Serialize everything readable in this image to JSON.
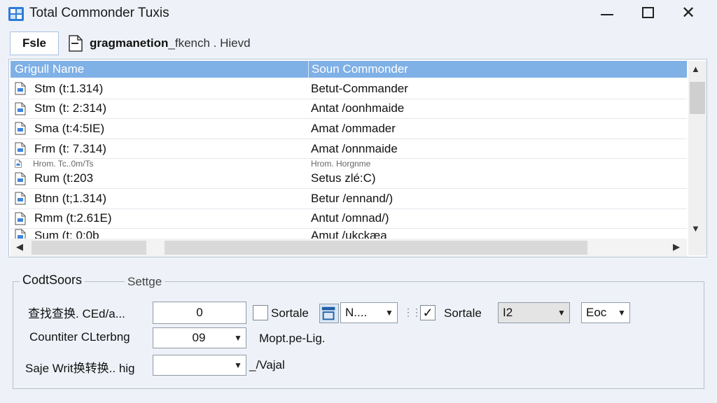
{
  "window": {
    "title": "Total Commonder Tuxis",
    "controls": {
      "minimize": "minimize",
      "maximize": "maximize",
      "close": "✕"
    }
  },
  "toolbar": {
    "file_label": "Fsle",
    "path_bold": "gragmanetion",
    "path_rest": "_fkench . Hievd"
  },
  "list": {
    "columns": [
      "Grigull Name",
      "Soun Commonder"
    ],
    "rows": [
      {
        "name": "Stm (t:1.314)",
        "value": "Betut-Commander",
        "size": "normal"
      },
      {
        "name": "Stm (t: 2:314)",
        "value": "Antat /oonhmaide",
        "size": "normal"
      },
      {
        "name": "Sma (t:4:5IE)",
        "value": "Amat /ommader",
        "size": "normal"
      },
      {
        "name": "Frm (t: 7.314)",
        "value": "Amat /onnmaide",
        "size": "normal"
      },
      {
        "name": "Hrom. Tc..0m/Ts",
        "value": "Hrom. Horgnme",
        "size": "small"
      },
      {
        "name": "Rum (t:203",
        "value": "Setus zlé:C)",
        "size": "normal"
      },
      {
        "name": "Btnn (t;1.314)",
        "value": "Betur /ennand/)",
        "size": "normal"
      },
      {
        "name": "Rmm (t:2.61E)",
        "value": "Antut /omnad/)",
        "size": "normal"
      },
      {
        "name": "Sum (t: 0:0b",
        "value": "Amut /ukckæa",
        "size": "cut"
      }
    ]
  },
  "settings": {
    "group_title": "CodtSoors",
    "group_subtitle": "Settge",
    "row1_label": "查找查换. CEd/a...",
    "row1_value": "0",
    "check1_label": "Sortale",
    "combo1_value": "N....",
    "check2_label": "Sortale",
    "check2_mark": "✓",
    "combo2_value": "I2",
    "combo3_value": "Eoc",
    "row2_label": "Countiter CLterbng",
    "row2_value": "09",
    "row2_text": "Mopt.pe-Lig.",
    "row3_label": "Saje Writ换转换.. hig",
    "row3_value": "",
    "row3_text": "_/Vajal"
  }
}
